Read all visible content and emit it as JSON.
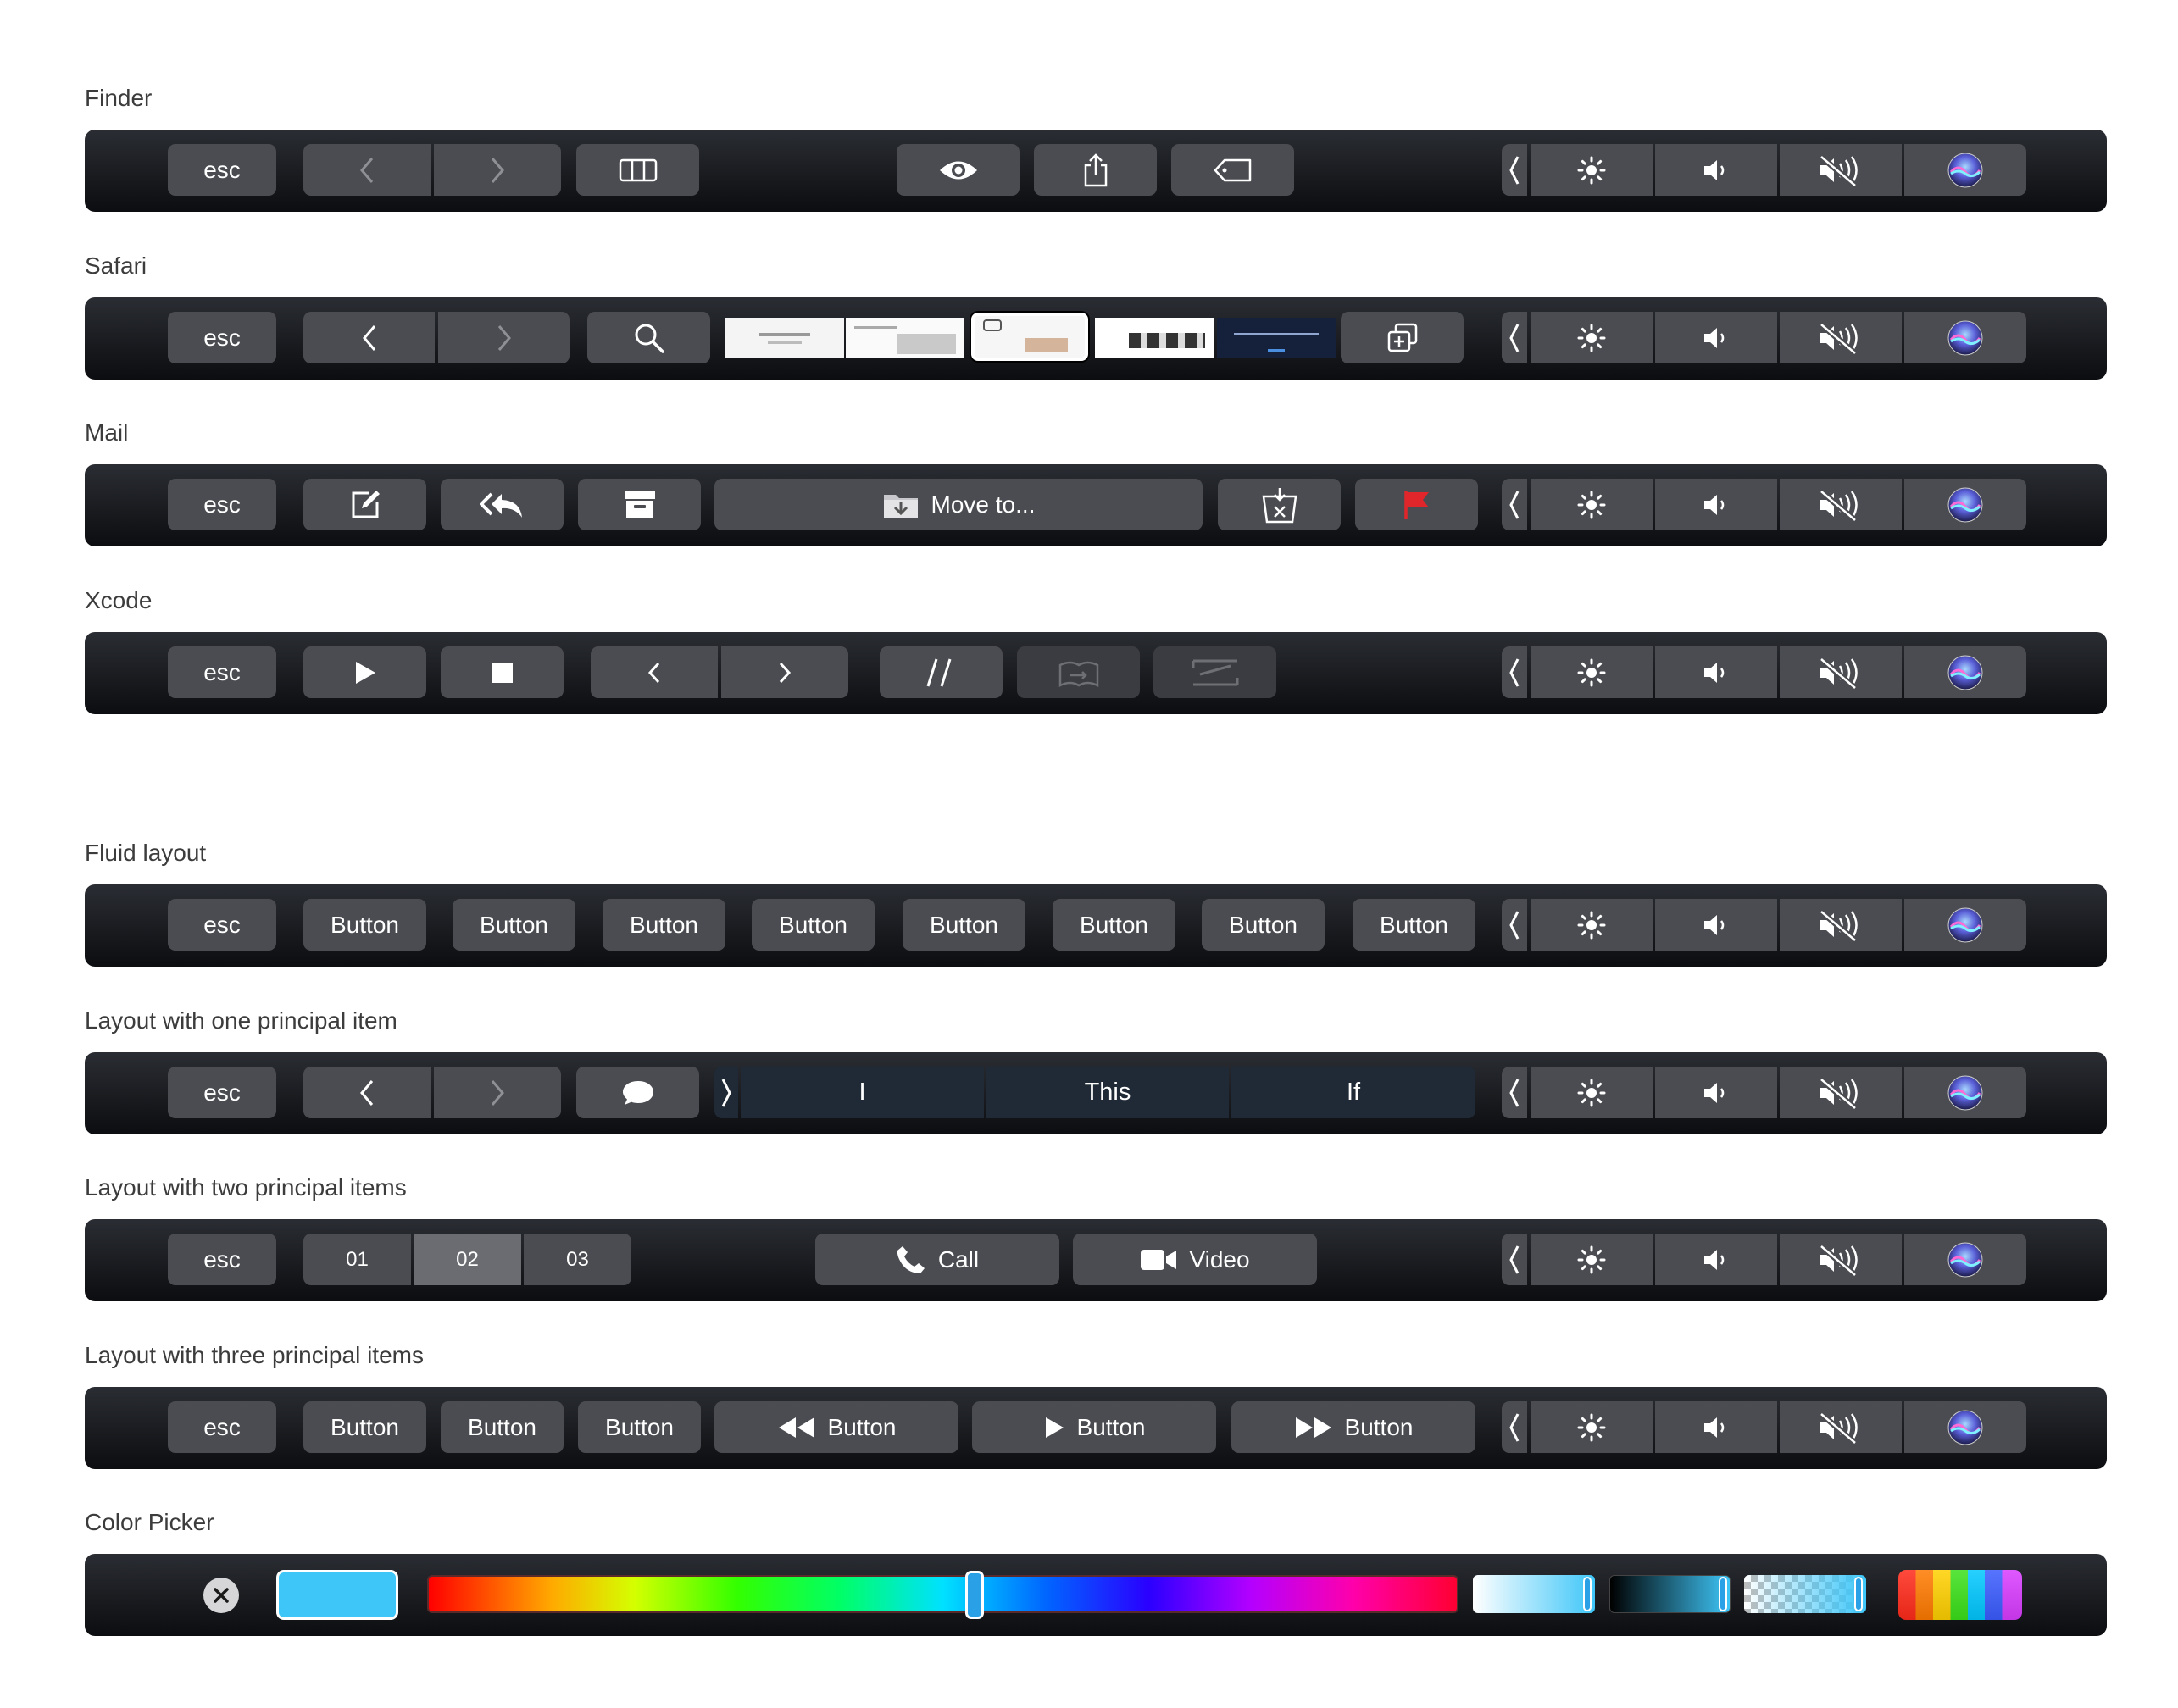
{
  "common": {
    "esc_label": "esc",
    "control_strip": [
      "expand-chevron-icon",
      "brightness-icon",
      "volume-icon",
      "mute-icon",
      "siri-icon"
    ]
  },
  "sections": {
    "finder": {
      "title": "Finder"
    },
    "safari": {
      "title": "Safari"
    },
    "mail": {
      "title": "Mail",
      "move_label": "Move to..."
    },
    "xcode": {
      "title": "Xcode"
    },
    "fluid": {
      "title": "Fluid layout",
      "buttons": [
        "Button",
        "Button",
        "Button",
        "Button",
        "Button",
        "Button",
        "Button",
        "Button"
      ]
    },
    "one_principal": {
      "title": "Layout with one principal item",
      "candidates": [
        "I",
        "This",
        "If"
      ]
    },
    "two_principal": {
      "title": "Layout with two principal items",
      "segments": [
        "01",
        "02",
        "03"
      ],
      "selected_segment": "02",
      "call_label": "Call",
      "video_label": "Video"
    },
    "three_principal": {
      "title": "Layout with three principal items",
      "buttons": [
        "Button",
        "Button",
        "Button"
      ],
      "media_buttons": [
        "Button",
        "Button",
        "Button"
      ]
    },
    "color_picker": {
      "title": "Color Picker",
      "selected_color": "#3ec6f8",
      "hue_position": 0.53
    }
  },
  "colors": {
    "flag_red": "#e0262b",
    "key_bg": "#4a4c51",
    "candidate_bg": "#1f2a36",
    "swatch": "#3ec6f8"
  }
}
